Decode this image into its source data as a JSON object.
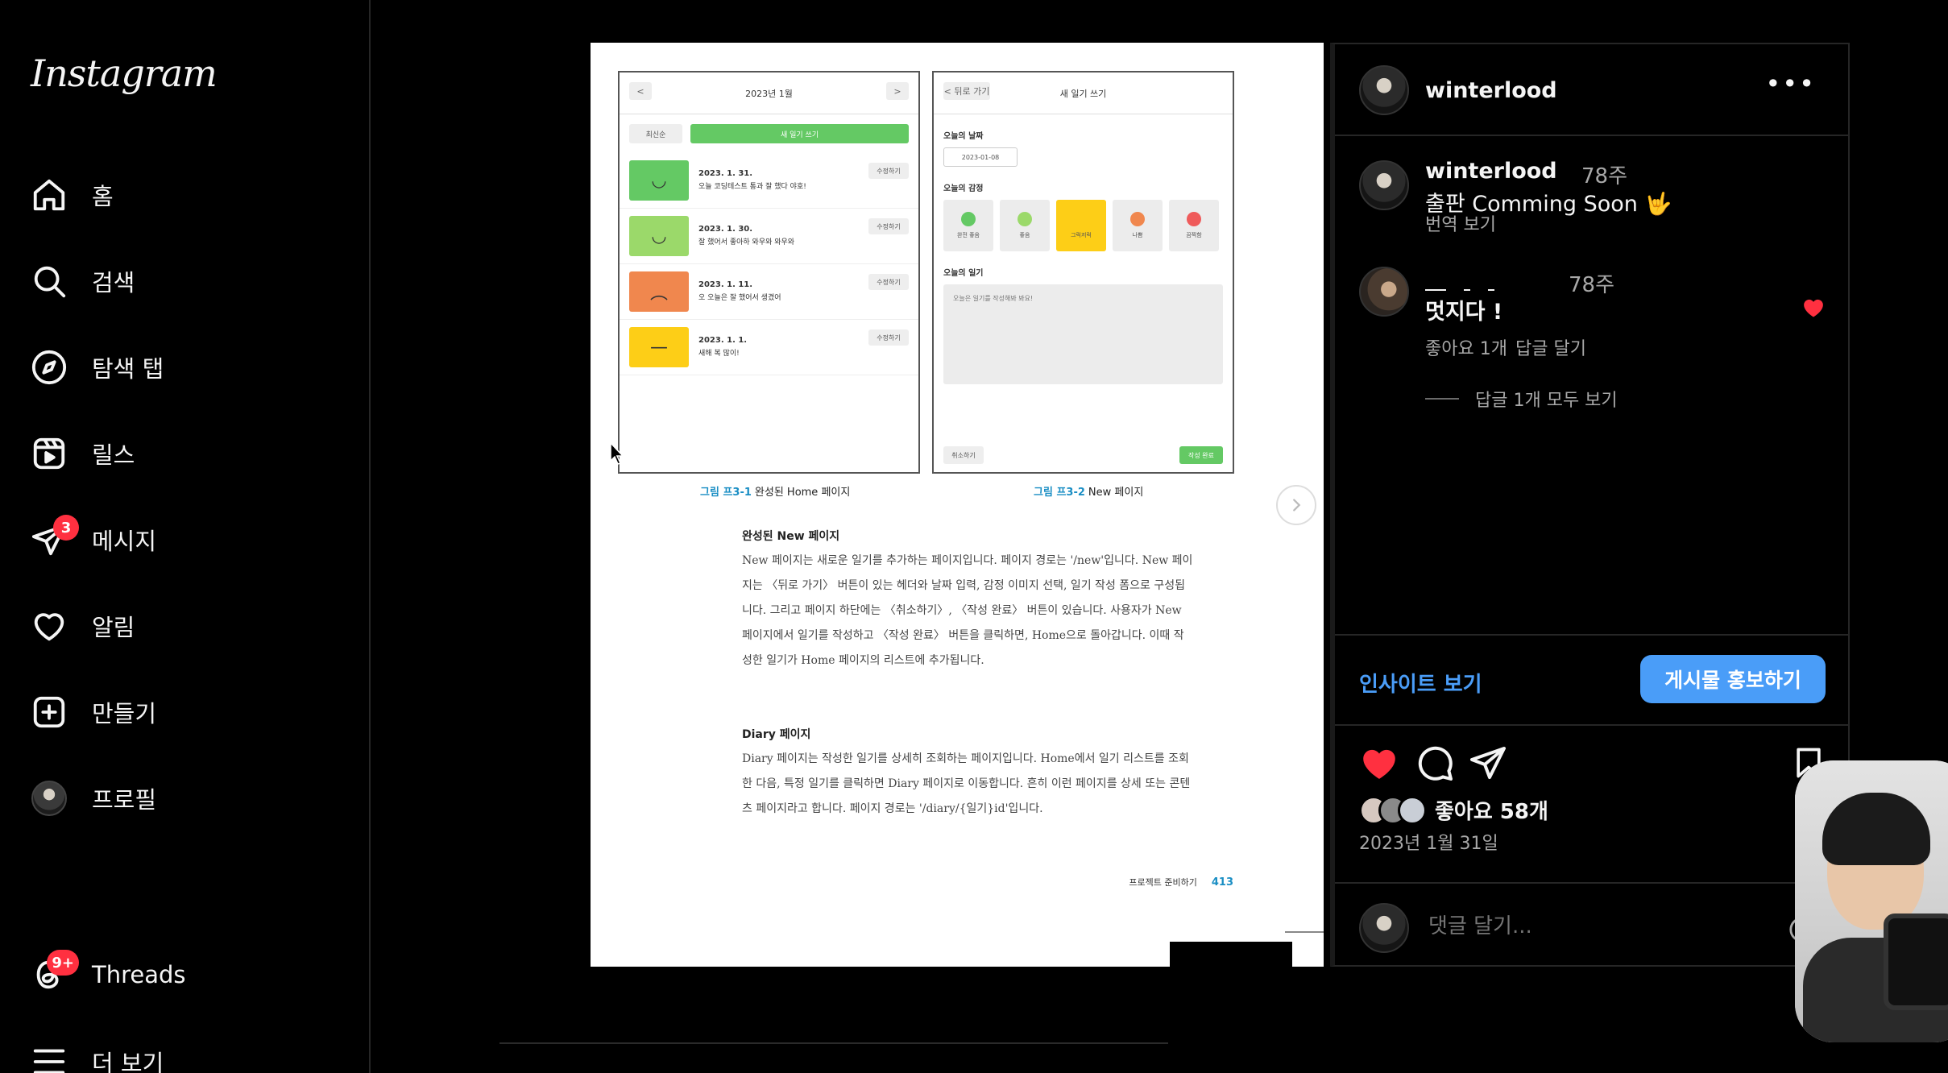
{
  "app": {
    "logo": "Instagram"
  },
  "sidebar": {
    "items": [
      {
        "label": "홈",
        "icon": "home-icon"
      },
      {
        "label": "검색",
        "icon": "search-icon"
      },
      {
        "label": "탐색 탭",
        "icon": "compass-icon"
      },
      {
        "label": "릴스",
        "icon": "reels-icon"
      },
      {
        "label": "메시지",
        "icon": "message-icon",
        "badge": "3"
      },
      {
        "label": "알림",
        "icon": "heart-icon"
      },
      {
        "label": "만들기",
        "icon": "plus-square-icon"
      },
      {
        "label": "프로필",
        "icon": "avatar"
      },
      {
        "label": "Threads",
        "icon": "threads-icon",
        "badge": "9+"
      },
      {
        "label": "더 보기",
        "icon": "menu-icon"
      }
    ]
  },
  "post_image": {
    "caption_left_num": "그림 프3-1",
    "caption_left_text": "완성된 Home 페이지",
    "caption_right_num": "그림 프3-2",
    "caption_right_text": "New 페이지",
    "section1_title": "완성된 New 페이지",
    "section1_body": "New 페이지는 새로운 일기를 추가하는 페이지입니다. 페이지 경로는 '/new'입니다. New 페이지는 〈뒤로 가기〉 버튼이 있는 헤더와 날짜 입력, 감정 이미지 선택, 일기 작성 폼으로 구성됩니다. 그리고 페이지 하단에는 〈취소하기〉, 〈작성 완료〉 버튼이 있습니다. 사용자가 New 페이지에서 일기를 작성하고 〈작성 완료〉 버튼을 클릭하면, Home으로 돌아갑니다. 이때 작성한 일기가 Home 페이지의 리스트에 추가됩니다.",
    "section2_title": "Diary 페이지",
    "section2_body": "Diary 페이지는 작성한 일기를 상세히 조회하는 페이지입니다. Home에서 일기 리스트를 조회한 다음, 특정 일기를 클릭하면 Diary 페이지로 이동합니다. 흔히 이런 페이지를 상세 또는 콘텐츠 페이지라고 합니다. 페이지 경로는 '/diary/{일기}id'입니다.",
    "footer_label": "프로젝트 준비하기",
    "page_number": "413",
    "home_mock": {
      "title": "2023년 1월",
      "sort": "최신순",
      "new_btn": "새 일기 쓰기",
      "rows": [
        {
          "date": "2023. 1. 31.",
          "text": "오늘 코딩테스트 통과 잘 했다 야호!",
          "color": "#64c964",
          "face": "◡"
        },
        {
          "date": "2023. 1. 30.",
          "text": "잘 했어서 좋아하 와우와 와우와",
          "color": "#9bd96a",
          "face": "◡"
        },
        {
          "date": "2023. 1. 11.",
          "text": "오 오늘은 잘 했어서 생겼어",
          "color": "#f0874e",
          "face": "︵"
        },
        {
          "date": "2023. 1. 1.",
          "text": "새해 복 많이!",
          "color": "#fdce17",
          "face": "—"
        }
      ],
      "edit": "수정하기"
    },
    "new_mock": {
      "back": "< 뒤로 가기",
      "title": "새 일기 쓰기",
      "date_label": "오늘의 날짜",
      "date_value": "2023-01-08",
      "emotion_label": "오늘의 감정",
      "emotions": [
        {
          "name": "완전 좋음",
          "color": "#64c964"
        },
        {
          "name": "좋음",
          "color": "#9bd96a"
        },
        {
          "name": "그럭저럭",
          "color": "#fdce17"
        },
        {
          "name": "나쁨",
          "color": "#f0874e"
        },
        {
          "name": "끔찍함",
          "color": "#ef5b5b"
        }
      ],
      "diary_label": "오늘의 일기",
      "diary_placeholder": "오늘은 일기를 작성해봐 봐요!",
      "cancel": "취소하기",
      "done": "작성 완료"
    }
  },
  "panel": {
    "header_user": "winterlood",
    "caption": {
      "user": "winterlood",
      "time": "78주",
      "text": "출판 Comming Soon 🤟",
      "translate": "번역 보기"
    },
    "comment": {
      "time": "78주",
      "text": "멋지다 !",
      "likes": "좋아요 1개",
      "reply": "답글 달기",
      "view_replies": "답글 1개 모두 보기"
    },
    "insight": "인사이트 보기",
    "promote": "게시물 홍보하기",
    "likes": "좋아요 58개",
    "date": "2023년 1월 31일",
    "comment_placeholder": "댓글 달기..."
  },
  "colors": {
    "accent_blue": "#4a9df8",
    "like_red": "#ff3040",
    "muted_text": "#a8a8a8"
  }
}
